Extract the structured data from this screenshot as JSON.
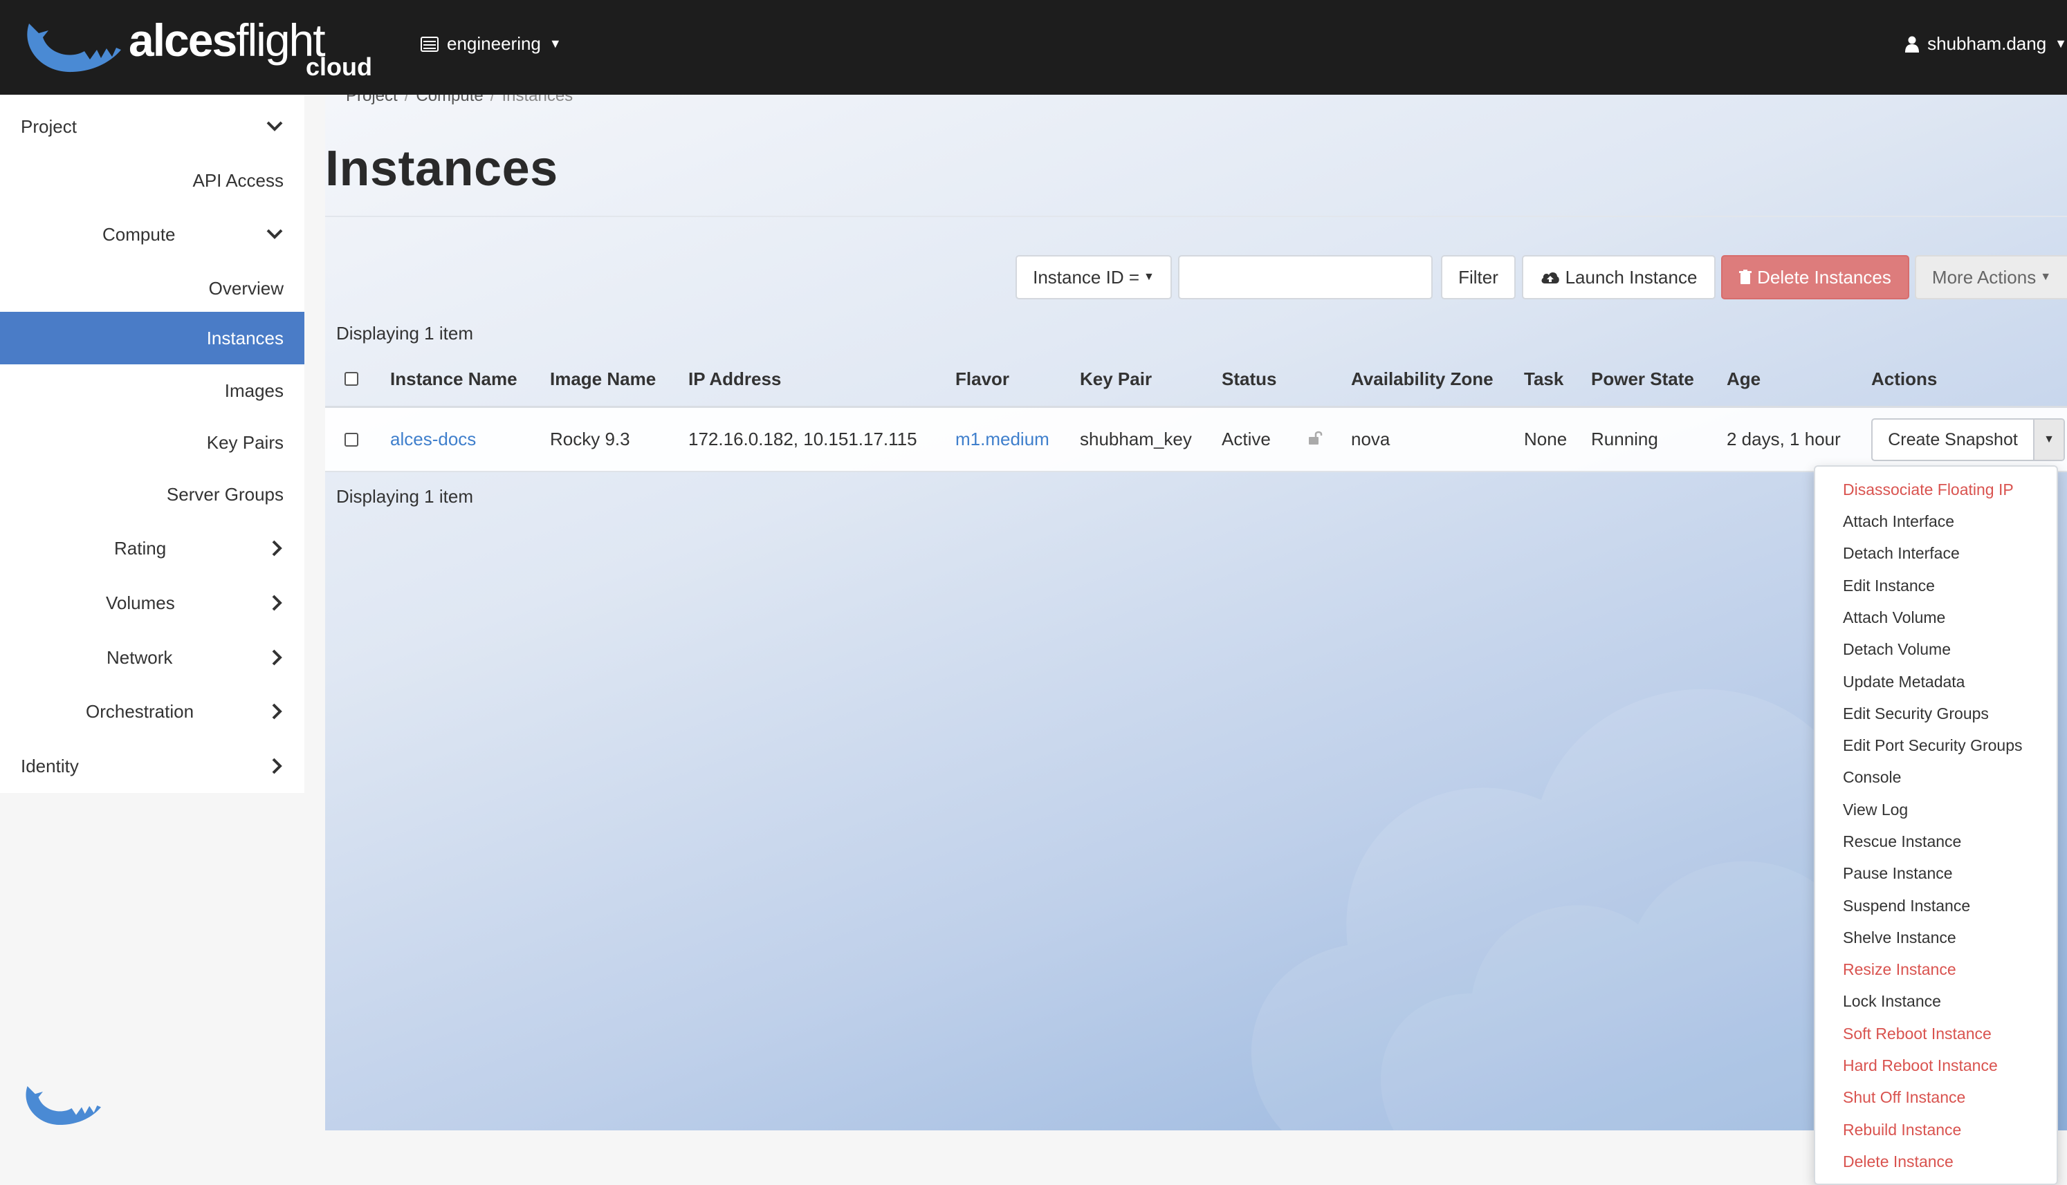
{
  "brand": {
    "name_bold": "alces",
    "name_light": "flight",
    "sub": "cloud"
  },
  "header": {
    "project": "engineering",
    "user": "shubham.dang"
  },
  "sidebar": {
    "items": [
      {
        "label": "Project",
        "chevron": "down"
      },
      {
        "label": "API Access"
      },
      {
        "label": "Compute",
        "chevron": "down"
      },
      {
        "label": "Overview"
      },
      {
        "label": "Instances",
        "active": true
      },
      {
        "label": "Images"
      },
      {
        "label": "Key Pairs"
      },
      {
        "label": "Server Groups"
      },
      {
        "label": "Rating",
        "chevron": "right"
      },
      {
        "label": "Volumes",
        "chevron": "right"
      },
      {
        "label": "Network",
        "chevron": "right"
      },
      {
        "label": "Orchestration",
        "chevron": "right"
      },
      {
        "label": "Identity",
        "chevron": "right"
      }
    ]
  },
  "breadcrumb": [
    "Project",
    "Compute",
    "Instances"
  ],
  "page": {
    "title": "Instances"
  },
  "toolbar": {
    "filter_field": "Instance ID =",
    "filter_value": "",
    "filter_button": "Filter",
    "launch_button": "Launch Instance",
    "delete_button": "Delete Instances",
    "more_button": "More Actions"
  },
  "table": {
    "count_label": "Displaying 1 item",
    "columns": [
      "Instance Name",
      "Image Name",
      "IP Address",
      "Flavor",
      "Key Pair",
      "Status",
      "Availability Zone",
      "Task",
      "Power State",
      "Age",
      "Actions"
    ],
    "rows": [
      {
        "name": "alces-docs",
        "image": "Rocky 9.3",
        "ip": "172.16.0.182, 10.151.17.115",
        "flavor": "m1.medium",
        "key_pair": "shubham_key",
        "status": "Active",
        "zone": "nova",
        "task": "None",
        "power_state": "Running",
        "age": "2 days, 1 hour",
        "action": "Create Snapshot"
      }
    ]
  },
  "actions_menu": [
    {
      "label": "Disassociate Floating IP",
      "danger": true
    },
    {
      "label": "Attach Interface"
    },
    {
      "label": "Detach Interface"
    },
    {
      "label": "Edit Instance"
    },
    {
      "label": "Attach Volume"
    },
    {
      "label": "Detach Volume"
    },
    {
      "label": "Update Metadata"
    },
    {
      "label": "Edit Security Groups"
    },
    {
      "label": "Edit Port Security Groups"
    },
    {
      "label": "Console"
    },
    {
      "label": "View Log"
    },
    {
      "label": "Rescue Instance"
    },
    {
      "label": "Pause Instance"
    },
    {
      "label": "Suspend Instance"
    },
    {
      "label": "Shelve Instance"
    },
    {
      "label": "Resize Instance",
      "danger": true
    },
    {
      "label": "Lock Instance"
    },
    {
      "label": "Soft Reboot Instance",
      "danger": true
    },
    {
      "label": "Hard Reboot Instance",
      "danger": true
    },
    {
      "label": "Shut Off Instance",
      "danger": true
    },
    {
      "label": "Rebuild Instance",
      "danger": true
    },
    {
      "label": "Delete Instance",
      "danger": true
    }
  ],
  "colors": {
    "accent": "#4a7cc7",
    "link": "#3f7fcc",
    "danger": "#d9534f",
    "topbar": "#1d1d1d"
  },
  "icons": [
    "paw-logo-icon",
    "server-icon",
    "user-icon",
    "chevron-down-icon",
    "chevron-right-icon",
    "cloud-upload-icon",
    "trash-icon",
    "unlock-icon",
    "caret-down-icon"
  ]
}
